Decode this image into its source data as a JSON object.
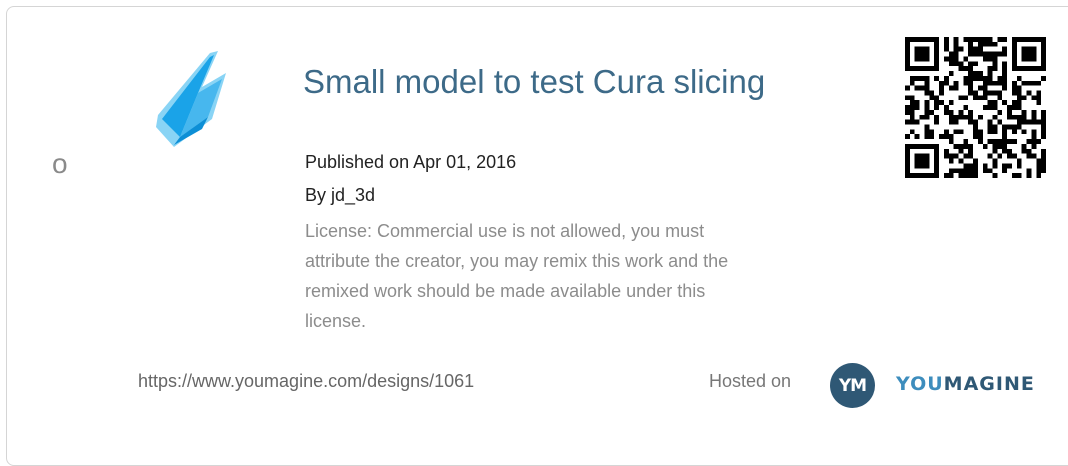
{
  "card": {
    "bullet": "o",
    "title": "Small model to test Cura slicing",
    "published": "Published on Apr 01, 2016",
    "author": "By jd_3d",
    "license": "License: Commercial use is not allowed, you must attribute the creator, you may remix this work and the remixed work should be made available under this license.",
    "url": "https://www.youmagine.com/designs/1061",
    "hosted_label": "Hosted on",
    "brand": {
      "badge": "YM",
      "wordmark_you": "YOU",
      "wordmark_magine": "MAGINE"
    }
  },
  "icons": {
    "thumbnail": "blue-model-thumbnail",
    "qr": "qr-code-icon"
  },
  "colors": {
    "title": "#3d6a88",
    "license": "#8c8c8c",
    "brand_dark": "#2f5875",
    "brand_light": "#3d8dbd"
  }
}
